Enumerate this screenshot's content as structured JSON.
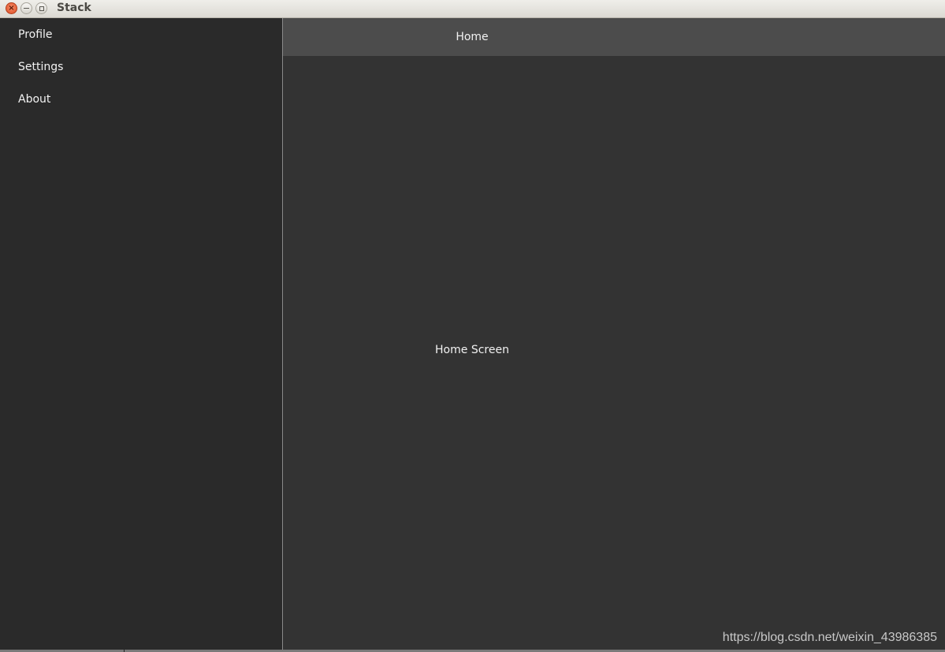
{
  "window": {
    "title": "Stack",
    "close_glyph": "×",
    "controls": [
      "close-icon",
      "minimize-icon",
      "maximize-icon"
    ]
  },
  "sidebar": {
    "items": [
      {
        "label": "Profile"
      },
      {
        "label": "Settings"
      },
      {
        "label": "About"
      }
    ]
  },
  "toolbar": {
    "title": "Home"
  },
  "main": {
    "screen_label": "Home Screen"
  },
  "watermark": {
    "text": "https://blog.csdn.net/weixin_43986385"
  },
  "colors": {
    "titlebar": "#e6e4de",
    "close_button": "#e8592f",
    "sidebar_bg": "#2a2a2a",
    "main_bg": "#333333",
    "toolbar_bg": "#4c4c4c",
    "text": "#f2f2f2"
  }
}
